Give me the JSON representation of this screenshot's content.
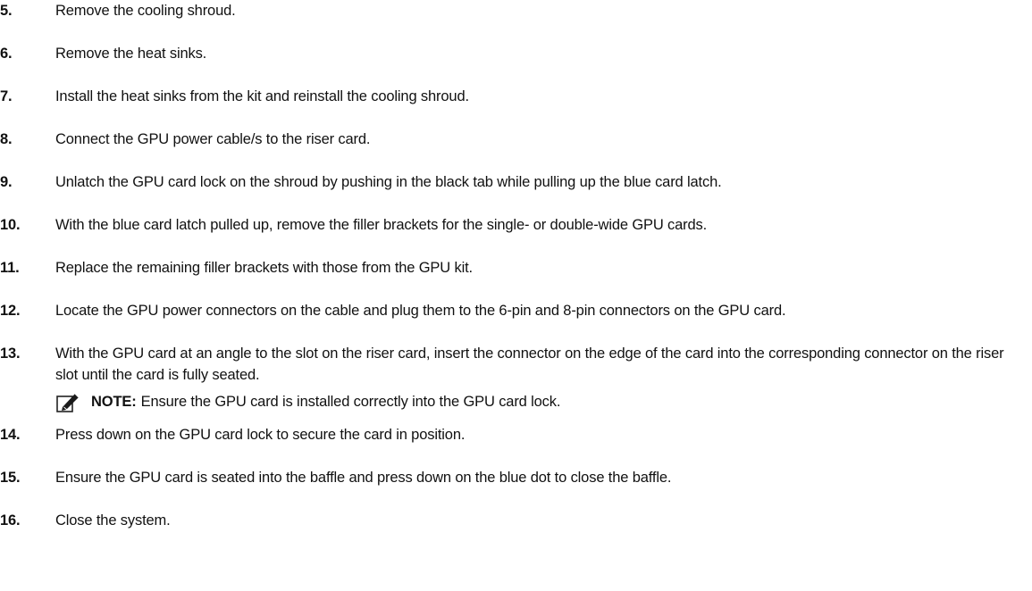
{
  "steps": [
    {
      "number": "5.",
      "text": "Remove the cooling shroud."
    },
    {
      "number": "6.",
      "text": "Remove the heat sinks."
    },
    {
      "number": "7.",
      "text": "Install the heat sinks from the kit and reinstall the cooling shroud."
    },
    {
      "number": "8.",
      "text": "Connect the GPU power cable/s to the riser card."
    },
    {
      "number": "9.",
      "text": "Unlatch the GPU card lock on the shroud by pushing in the black tab while pulling up the blue card latch."
    },
    {
      "number": "10.",
      "text": "With the blue card latch pulled up, remove the filler brackets for the single- or double-wide GPU cards."
    },
    {
      "number": "11.",
      "text": "Replace the remaining filler brackets with those from the GPU kit."
    },
    {
      "number": "12.",
      "text": "Locate the GPU power connectors on the cable and plug them to the 6-pin and 8-pin connectors on the GPU card."
    },
    {
      "number": "13.",
      "text": "With the GPU card at an angle to the slot on the riser card, insert the connector on the edge of the card into the corresponding connector on the riser slot until the card is fully seated."
    },
    {
      "number": "14.",
      "text": "Press down on the GPU card lock to secure the card in position."
    },
    {
      "number": "15.",
      "text": "Ensure the GPU card is seated into the baffle and press down on the blue dot to close the baffle."
    },
    {
      "number": "16.",
      "text": "Close the system."
    }
  ],
  "note": {
    "icon": "pencil-note-icon",
    "label": "NOTE:",
    "text": "Ensure the GPU card is installed correctly into the GPU card lock."
  }
}
